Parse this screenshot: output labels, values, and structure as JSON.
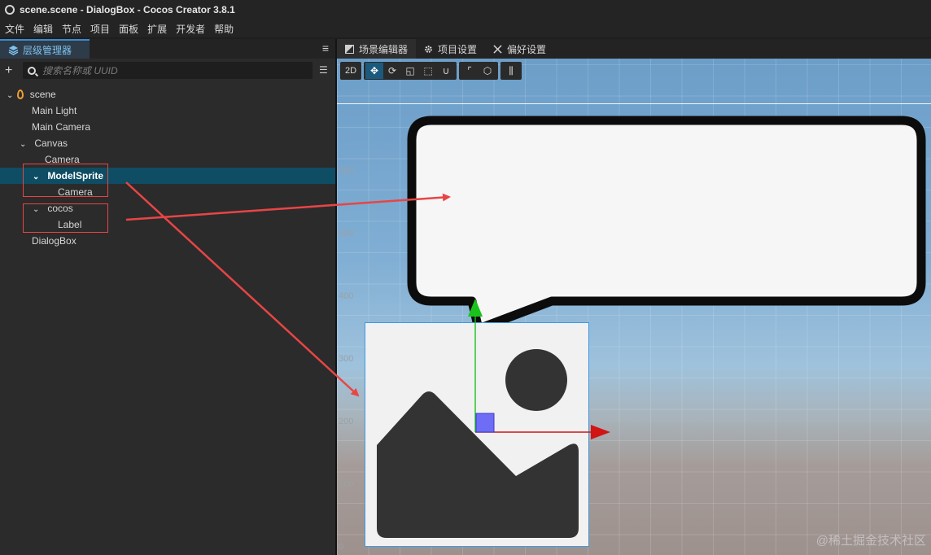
{
  "window": {
    "title": "scene.scene - DialogBox - Cocos Creator 3.8.1"
  },
  "menu": [
    "文件",
    "编辑",
    "节点",
    "项目",
    "面板",
    "扩展",
    "开发者",
    "帮助"
  ],
  "hierarchy": {
    "tab_label": "层级管理器",
    "search_placeholder": "搜索名称或 UUID",
    "nodes": [
      {
        "label": "scene",
        "depth": 0,
        "expanded": true,
        "icon": "scene-icon"
      },
      {
        "label": "Main Light",
        "depth": 1
      },
      {
        "label": "Main Camera",
        "depth": 1
      },
      {
        "label": "Canvas",
        "depth": 1,
        "expanded": true
      },
      {
        "label": "Camera",
        "depth": 2
      },
      {
        "label": "ModelSprite",
        "depth": 2,
        "expanded": true,
        "selected": true
      },
      {
        "label": "Camera",
        "depth": 3
      },
      {
        "label": "cocos",
        "depth": 2,
        "expanded": true
      },
      {
        "label": "Label",
        "depth": 3
      },
      {
        "label": "DialogBox",
        "depth": 1
      }
    ]
  },
  "scene_editor": {
    "tabs": [
      "场景编辑器",
      "项目设置",
      "偏好设置"
    ],
    "toolbar": {
      "mode_2d": "2D"
    },
    "ruler_labels": [
      "600",
      "500",
      "400",
      "300",
      "200",
      "100",
      "0"
    ]
  },
  "watermark": "@稀土掘金技术社区",
  "colors": {
    "selection": "#0e4d63",
    "annotation": "#e84545",
    "gizmo_y": "#19c31c",
    "gizmo_x": "#d11414",
    "selection_box": "#3a9ae6"
  }
}
